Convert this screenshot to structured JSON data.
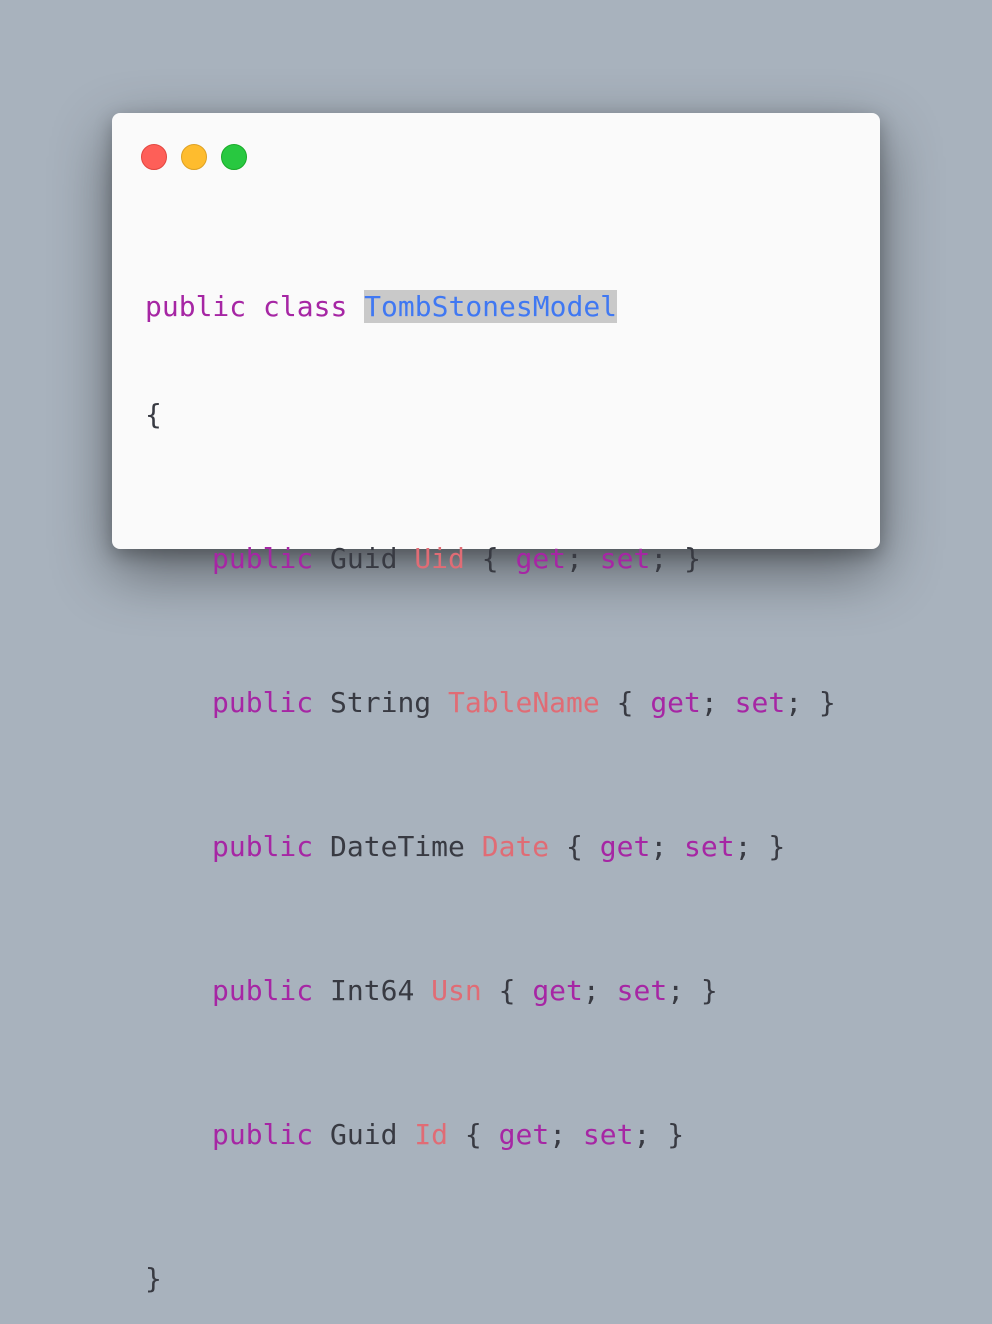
{
  "window": {
    "controls": {
      "close_color": "#fe5f58",
      "minimize_color": "#febc2e",
      "maximize_color": "#28c840"
    }
  },
  "code": {
    "header": {
      "kw1": "public",
      "kw2": "class",
      "name": "TombStonesModel"
    },
    "open_brace": "{",
    "close_brace": "}",
    "properties": [
      {
        "modifier": "public",
        "type": "Guid",
        "name": "Uid",
        "open": "{",
        "get": "get",
        "semi1": ";",
        "set": "set",
        "semi2": ";",
        "close": "}"
      },
      {
        "modifier": "public",
        "type": "String",
        "name": "TableName",
        "open": "{",
        "get": "get",
        "semi1": ";",
        "set": "set",
        "semi2": ";",
        "close": "}"
      },
      {
        "modifier": "public",
        "type": "DateTime",
        "name": "Date",
        "open": "{",
        "get": "get",
        "semi1": ";",
        "set": "set",
        "semi2": ";",
        "close": "}"
      },
      {
        "modifier": "public",
        "type": "Int64",
        "name": "Usn",
        "open": "{",
        "get": "get",
        "semi1": ";",
        "set": "set",
        "semi2": ";",
        "close": "}"
      },
      {
        "modifier": "public",
        "type": "Guid",
        "name": "Id",
        "open": "{",
        "get": "get",
        "semi1": ";",
        "set": "set",
        "semi2": ";",
        "close": "}"
      }
    ]
  },
  "colors": {
    "background": "#a8b2bd",
    "card": "#fafafa",
    "keyword": "#a626a4",
    "property": "#e06c75",
    "class_name": "#4078f2",
    "selection": "#c9c9c9",
    "text": "#383a42"
  }
}
